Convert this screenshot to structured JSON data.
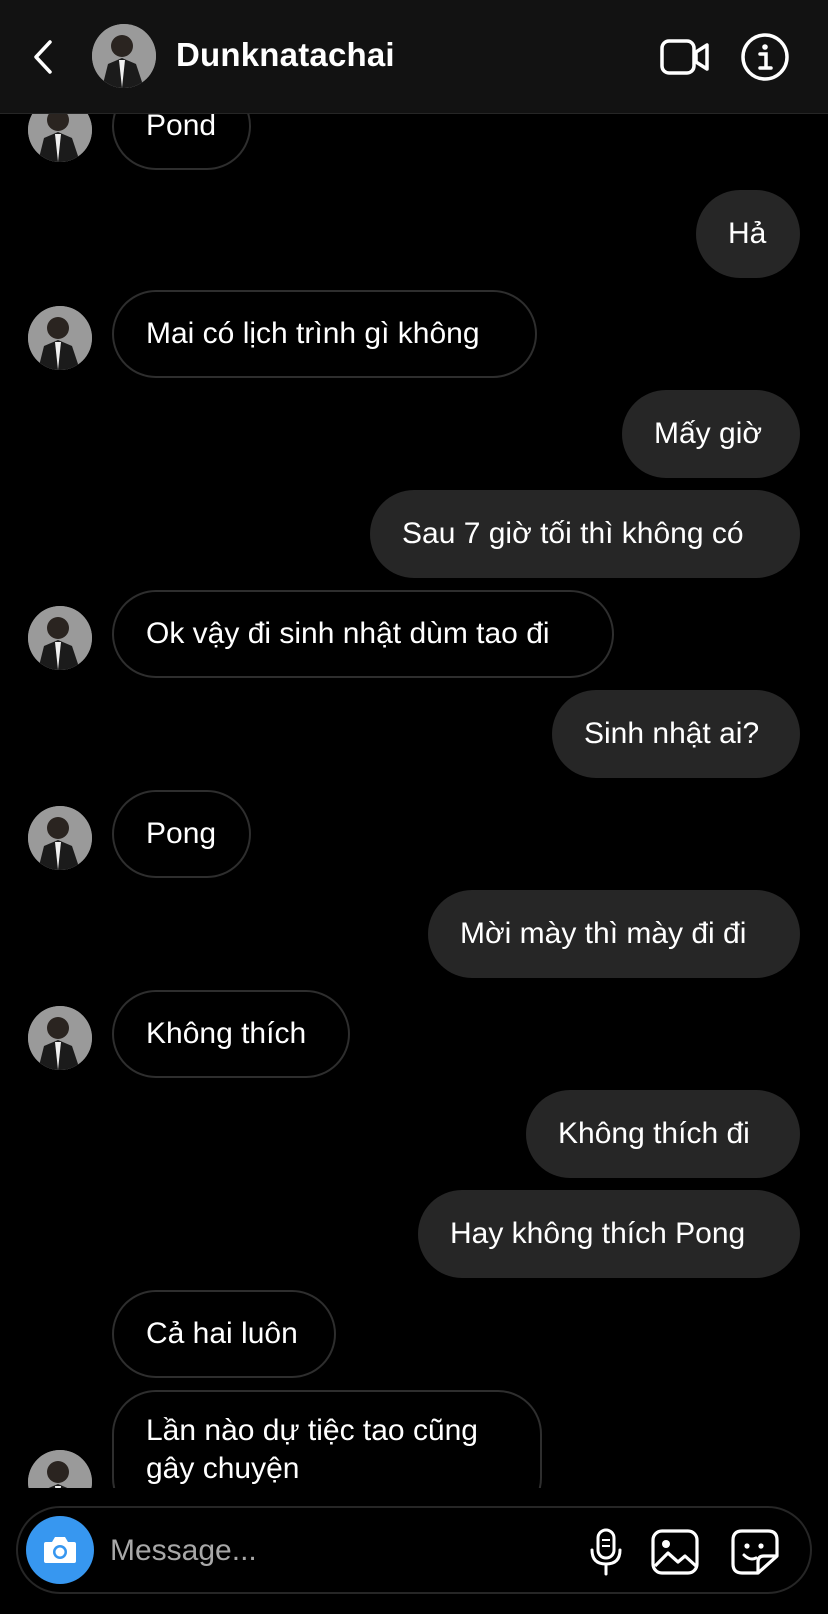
{
  "header": {
    "contact_name": "Dunknatachai",
    "icons": [
      "back-chevron-icon",
      "avatar",
      "video-call-icon",
      "info-icon"
    ]
  },
  "messages": [
    {
      "side": "in",
      "text": "Pond",
      "avatar": true
    },
    {
      "side": "out",
      "text": "Hả"
    },
    {
      "side": "in",
      "text": "Mai có lịch trình gì không",
      "avatar": true
    },
    {
      "side": "out",
      "text": "Mấy giờ"
    },
    {
      "side": "out",
      "text": "Sau 7 giờ tối thì không có"
    },
    {
      "side": "in",
      "text": "Ok vậy đi sinh nhật dùm tao đi",
      "avatar": true
    },
    {
      "side": "out",
      "text": "Sinh nhật ai?"
    },
    {
      "side": "in",
      "text": "Pong",
      "avatar": true
    },
    {
      "side": "out",
      "text": "Mời mày thì mày đi đi"
    },
    {
      "side": "in",
      "text": "Không thích",
      "avatar": true
    },
    {
      "side": "out",
      "text": "Không thích đi"
    },
    {
      "side": "out",
      "text": "Hay không thích Pong"
    },
    {
      "side": "in",
      "text": "Cả hai luôn",
      "avatar": false
    },
    {
      "side": "in",
      "text": "Lần nào dự tiệc tao cũng gây chuyện",
      "avatar": true
    }
  ],
  "composer": {
    "placeholder": "Message...",
    "icons": [
      "camera-icon",
      "microphone-icon",
      "gallery-icon",
      "sticker-icon"
    ]
  },
  "colors": {
    "background": "#000000",
    "header_bg": "#121212",
    "outgoing_bubble": "#262626",
    "incoming_border": "#2e2e2e",
    "camera_button": "#3797f0",
    "placeholder": "#a8a8a8"
  }
}
